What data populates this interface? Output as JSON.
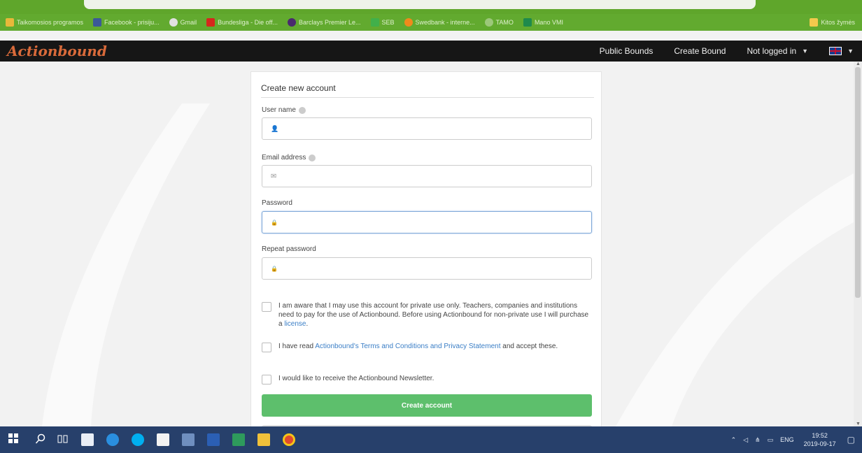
{
  "browser": {
    "bookmarks": [
      {
        "label": "Taikomosios programos",
        "color": "#e8b83a"
      },
      {
        "label": "Facebook - prisiju...",
        "color": "#3b5998"
      },
      {
        "label": "Gmail",
        "color": "#e0e0e0"
      },
      {
        "label": "Bundesliga - Die off...",
        "color": "#d6271c"
      },
      {
        "label": "Barclays Premier Le...",
        "color": "#4a2a6e"
      },
      {
        "label": "SEB",
        "color": "#41b04a"
      },
      {
        "label": "Swedbank - interne...",
        "color": "#f08a1c"
      },
      {
        "label": "TAMO",
        "color": "#9cc87a"
      },
      {
        "label": "Mano VMI",
        "color": "#1f8a4c"
      }
    ],
    "other_bookmarks": "Kitos žymės"
  },
  "nav": {
    "logo": "Actionbound",
    "public_bounds": "Public Bounds",
    "create_bound": "Create Bound",
    "login_status": "Not logged in",
    "caret": "▼"
  },
  "form": {
    "title": "Create new account",
    "username_label": "User name",
    "email_label": "Email address",
    "password_label": "Password",
    "repeat_password_label": "Repeat password",
    "checkbox_private": {
      "text_before_link": "I am aware that I may use this account for private use only. Teachers, companies and institutions need to pay for the use of Actionbound. Before using Actionbound for non-private use I will purchase a ",
      "link": "license",
      "text_after_link": "."
    },
    "checkbox_terms": {
      "text_before_link": "I have read ",
      "link": "Actionbound's Terms and Conditions and Privacy Statement",
      "text_after_link": " and accept these."
    },
    "checkbox_newsletter": "I would like to receive the Actionbound Newsletter.",
    "submit_label": "Create account"
  },
  "icons": {
    "user": "👤",
    "email": "✉",
    "lock": "🔒"
  },
  "taskbar": {
    "language": "ENG",
    "time": "19:52",
    "date": "2019-09-17"
  },
  "colors": {
    "browser_green": "#5fa62b",
    "nav_bg": "#161616",
    "logo": "#d96a3a",
    "button_green": "#5dbf6c",
    "link_blue": "#3a7ec6",
    "taskbar": "#27406b"
  }
}
